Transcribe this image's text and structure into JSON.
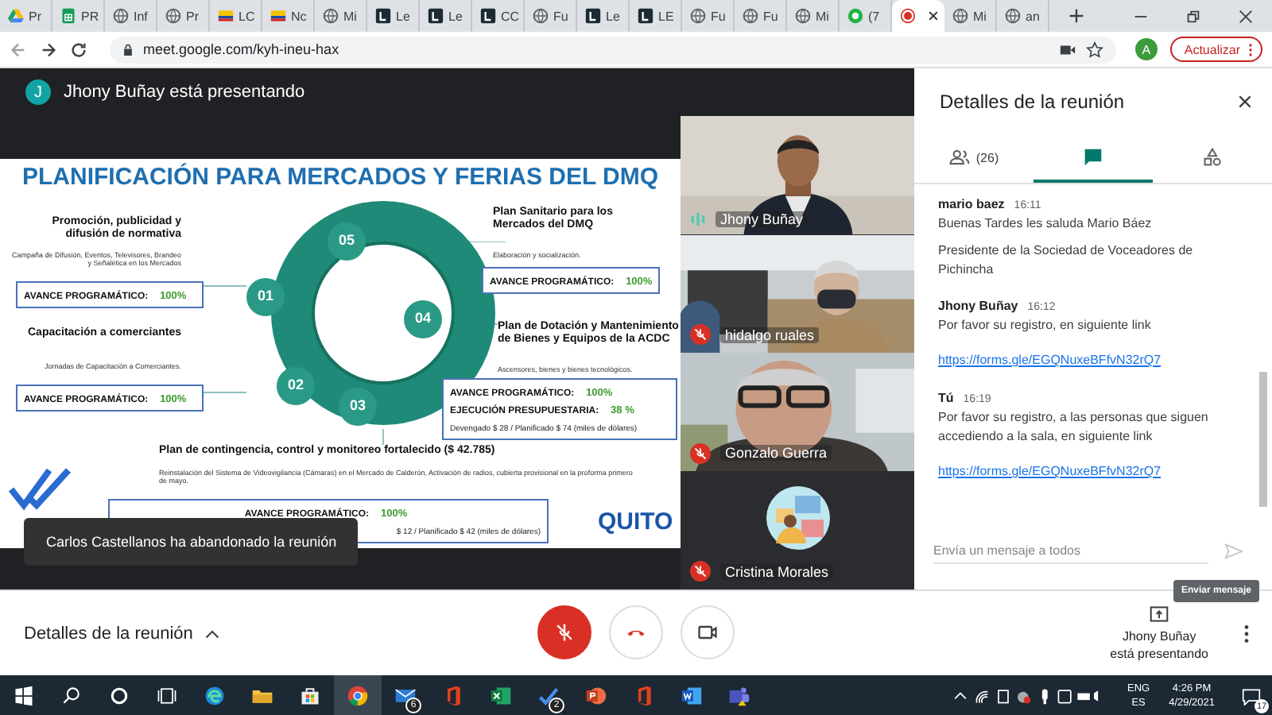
{
  "browser": {
    "tabs": [
      {
        "label": "Pr",
        "kind": "drive",
        "selected": false
      },
      {
        "label": "PR",
        "kind": "sheets",
        "selected": false
      },
      {
        "label": "Inf",
        "kind": "globe",
        "selected": false
      },
      {
        "label": "Pr",
        "kind": "globe",
        "selected": false
      },
      {
        "label": "LC",
        "kind": "flag",
        "selected": false
      },
      {
        "label": "Nc",
        "kind": "flag",
        "selected": false
      },
      {
        "label": "Mi",
        "kind": "globe",
        "selected": false
      },
      {
        "label": "Le",
        "kind": "square",
        "selected": false
      },
      {
        "label": "Le",
        "kind": "square",
        "selected": false
      },
      {
        "label": "CC",
        "kind": "square",
        "selected": false
      },
      {
        "label": "Fu",
        "kind": "globe",
        "selected": false
      },
      {
        "label": "Le",
        "kind": "square",
        "selected": false
      },
      {
        "label": "LE",
        "kind": "square",
        "selected": false
      },
      {
        "label": "Fu",
        "kind": "globe",
        "selected": false
      },
      {
        "label": "Fu",
        "kind": "globe",
        "selected": false
      },
      {
        "label": "Mi",
        "kind": "globe",
        "selected": false
      },
      {
        "label": "(7",
        "kind": "green",
        "selected": false
      },
      {
        "kind": "record",
        "selected": true
      },
      {
        "label": "Mi",
        "kind": "globe",
        "selected": false
      },
      {
        "label": "an",
        "kind": "globe",
        "selected": false
      }
    ],
    "url": "meet.google.com/kyh-ineu-hax",
    "profile": "A",
    "update_button": "Actualizar"
  },
  "presenter_banner": {
    "avatar": "J",
    "text": "Jhony Buñay está presentando"
  },
  "slide": {
    "title": "PLANIFICACIÓN PARA MERCADOS Y FERIAS DEL DMQ",
    "ring_labels": [
      "05",
      "01",
      "04",
      "02",
      "03"
    ],
    "items": [
      {
        "heading": "Promoción, publicidad y difusión de normativa",
        "description": "Campaña de Difusión, Eventos, Televisores, Brandeo y Señalética en los Mercados",
        "box": [
          {
            "label": "AVANCE PROGRAMÁTICO:",
            "value": "100%"
          }
        ]
      },
      {
        "heading": "Capacitación a comerciantes",
        "description": "Jornadas de Capacitación a Comerciantes.",
        "box": [
          {
            "label": "AVANCE PROGRAMÁTICO:",
            "value": "100%"
          }
        ]
      },
      {
        "heading": "Plan Sanitario para los Mercados del DMQ",
        "description": "Elaboración y socialización.",
        "box": [
          {
            "label": "AVANCE PROGRAMÁTICO:",
            "value": "100%"
          }
        ]
      },
      {
        "heading": "Plan de Dotación y Mantenimiento de Bienes y Equipos de la ACDC",
        "description": "Ascensores, bienes y bienes  tecnológicos.",
        "box": [
          {
            "label": "AVANCE PROGRAMÁTICO:",
            "value": "100%"
          },
          {
            "label": "EJECUCIÓN PRESUPUESTARIA:",
            "value": "38 %",
            "note": "Devengado $ 28 / Planificado $ 74 (miles de dólares)"
          }
        ]
      },
      {
        "heading": "Plan de contingencia, control y monitoreo fortalecido ($ 42.785)",
        "description": "Reinstalación del Sistema de Videovigilancia (Cámaras) en el Mercado de Calderón, Activación de radios, cubierta provisional en la proforma primero de mayo.",
        "box": [
          {
            "label": "AVANCE PROGRAMÁTICO:",
            "value": "100%"
          },
          {
            "note": "$ 12 / Planificado $ 42 (miles de dólares)"
          }
        ]
      }
    ],
    "logo": "QUITO"
  },
  "toast": "Carlos Castellanos ha abandonado la reunión",
  "participants": [
    {
      "name": "Jhony Buñay",
      "muted": false,
      "video": true
    },
    {
      "name": "hidalgo ruales",
      "muted": true,
      "video": true
    },
    {
      "name": "Gonzalo Guerra",
      "muted": true,
      "video": true
    },
    {
      "name": "Cristina Morales",
      "muted": true,
      "video": false
    }
  ],
  "panel": {
    "title": "Detalles de la reunión",
    "tabs": [
      {
        "kind": "people",
        "count": "(26)",
        "selected": false
      },
      {
        "kind": "chat",
        "selected": true
      },
      {
        "kind": "activities",
        "selected": false
      }
    ],
    "messages": [
      {
        "sender": "mario baez",
        "time": "16:11",
        "parts": [
          {
            "kind": "text",
            "text": "Buenas Tardes les saluda Mario Báez"
          },
          {
            "kind": "text",
            "text": "Presidente de la Sociedad de Voceadores de Pichincha"
          }
        ]
      },
      {
        "sender": "Jhony Buñay",
        "time": "16:12",
        "parts": [
          {
            "kind": "text",
            "text": "Por favor su registro, en siguiente link"
          },
          {
            "kind": "link",
            "text": "https://forms.gle/EGQNuxeBFfvN32rQ7"
          }
        ]
      },
      {
        "sender": "Tú",
        "time": "16:19",
        "parts": [
          {
            "kind": "text",
            "text": "Por favor su registro, a las personas que siguen accediendo a la sala, en siguiente link"
          },
          {
            "kind": "link",
            "text": "https://forms.gle/EGQNuxeBFfvN32rQ7"
          }
        ]
      }
    ],
    "input_placeholder": "Envía un mensaje a todos",
    "tooltip": "Enviar mensaje"
  },
  "bottom_bar": {
    "details": "Detalles de la reunión",
    "controls": [
      {
        "kind": "mic",
        "on": false
      },
      {
        "kind": "hangup"
      },
      {
        "kind": "camera",
        "on": true
      }
    ],
    "presenting": [
      "Jhony Buñay",
      "está presentando"
    ]
  },
  "taskbar": {
    "apps": [
      {
        "kind": "start",
        "active": false
      },
      {
        "kind": "search",
        "active": false
      },
      {
        "kind": "cortana",
        "active": false
      },
      {
        "kind": "taskview",
        "active": false
      },
      {
        "kind": "edge",
        "active": false
      },
      {
        "kind": "explorer",
        "active": false
      },
      {
        "kind": "store",
        "active": false
      },
      {
        "kind": "chrome",
        "active": true
      },
      {
        "kind": "mail",
        "active": false,
        "badge": "6"
      },
      {
        "kind": "office",
        "active": false
      },
      {
        "kind": "excel",
        "active": false
      },
      {
        "kind": "todo",
        "active": false,
        "badge": "2"
      },
      {
        "kind": "powerpoint",
        "active": false
      },
      {
        "kind": "office",
        "active": false
      },
      {
        "kind": "word",
        "active": false
      },
      {
        "kind": "teams",
        "active": false
      }
    ],
    "languages": [
      "ENG",
      "ES"
    ],
    "time": "4:26 PM",
    "date": "4/29/2021",
    "notifications": "17"
  }
}
